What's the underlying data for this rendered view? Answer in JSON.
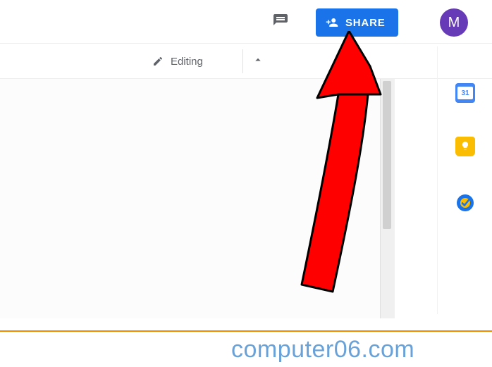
{
  "header": {
    "share_label": "SHARE",
    "avatar_initial": "M"
  },
  "toolbar": {
    "mode_label": "Editing"
  },
  "sidepanel": {
    "calendar_day": "31"
  },
  "watermark": {
    "text": "computer06.com"
  }
}
